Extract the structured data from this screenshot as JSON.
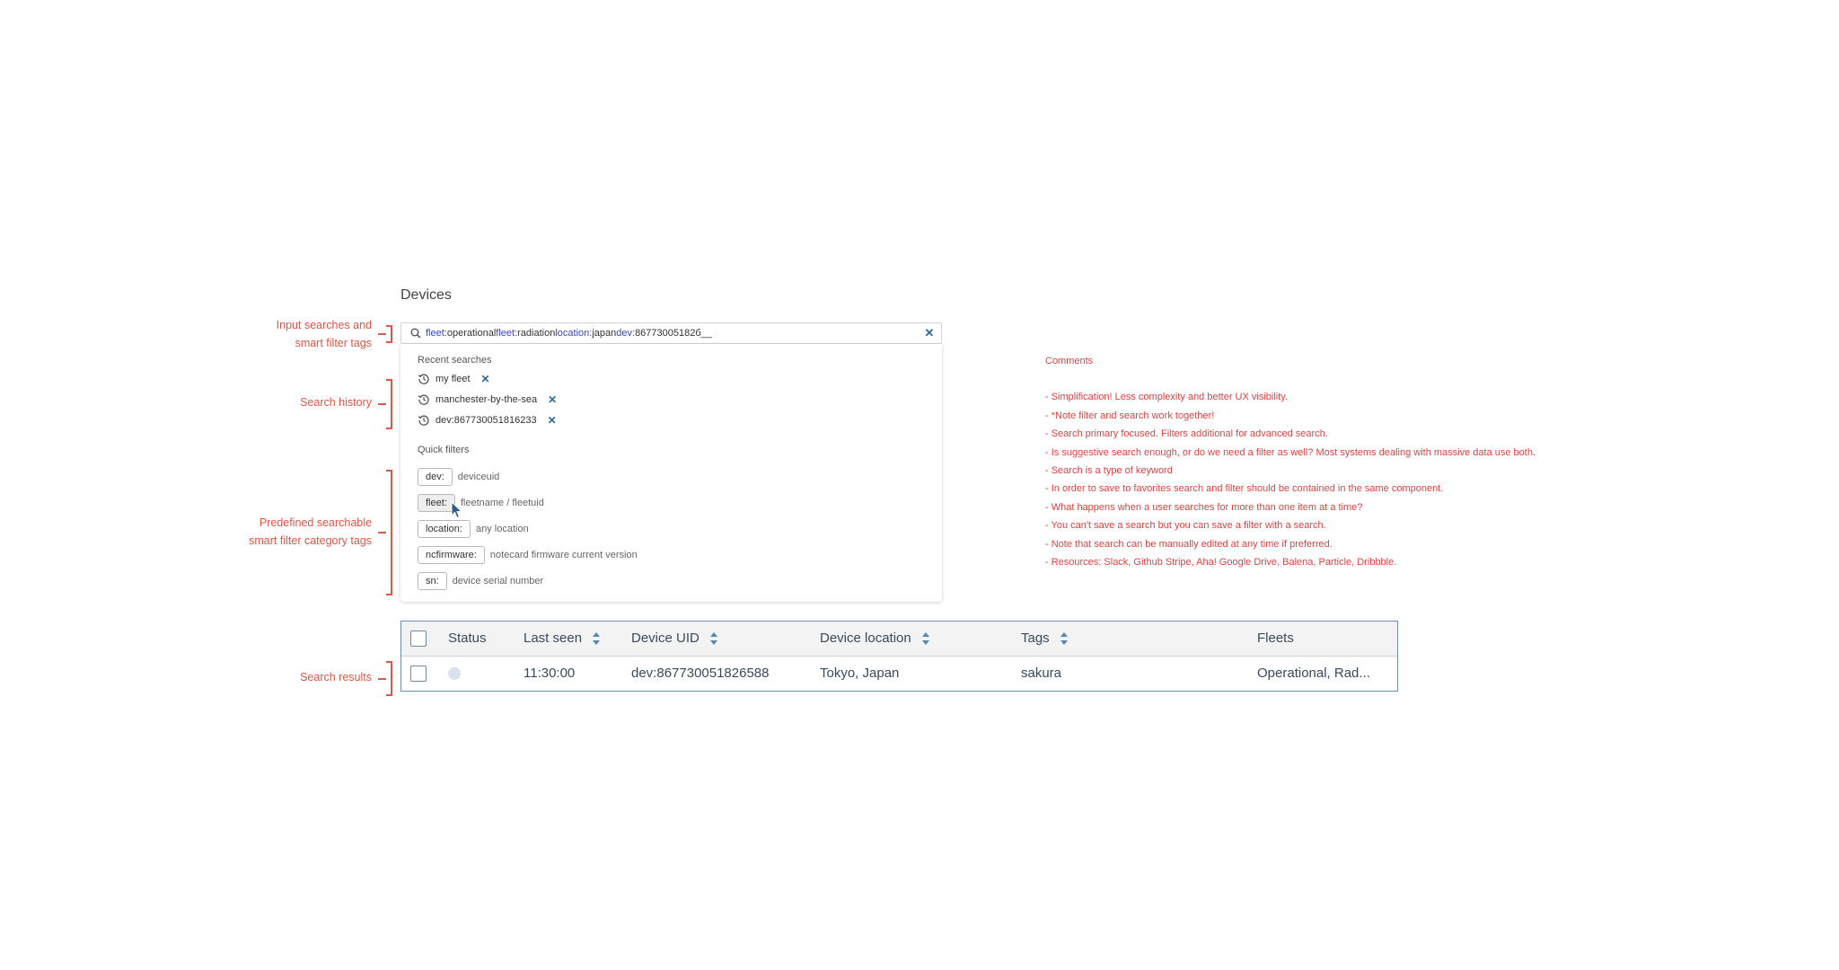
{
  "annotations": {
    "input": "Input searches and smart filter tags",
    "history": "Search history",
    "predefined": "Predefined searchable smart filter category tags",
    "results": "Search results"
  },
  "page": {
    "title": "Devices"
  },
  "search": {
    "tokens": [
      {
        "key": "fleet:",
        "value": "operational "
      },
      {
        "key": "fleet:",
        "value": "radiation "
      },
      {
        "key": "location:",
        "value": "japan "
      },
      {
        "key": "dev:",
        "value": "86773005182б__"
      }
    ],
    "clear_icon": "close-icon"
  },
  "dropdown": {
    "recent_heading": "Recent searches",
    "recent": [
      {
        "label": "my fleet"
      },
      {
        "label": "manchester-by-the-sea"
      },
      {
        "label": "dev:867730051816233"
      }
    ],
    "quick_heading": "Quick filters",
    "quick": [
      {
        "chip": "dev:",
        "desc": "deviceuid"
      },
      {
        "chip": "fleet:",
        "desc": "fleetname / fleetuid"
      },
      {
        "chip": "location:",
        "desc": "any location"
      },
      {
        "chip": "ncfirmware:",
        "desc": "notecard firmware current version"
      },
      {
        "chip": "sn:",
        "desc": "device serial number"
      }
    ]
  },
  "table": {
    "headers": {
      "status": "Status",
      "last_seen": "Last seen",
      "device_uid": "Device UID",
      "device_location": "Device location",
      "tags": "Tags",
      "fleets": "Fleets"
    },
    "rows": [
      {
        "last_seen": "11:30:00",
        "device_uid": "dev:867730051826588",
        "device_location": "Tokyo, Japan",
        "tags": "sakura",
        "fleets": "Operational, Rad..."
      }
    ]
  },
  "comments": {
    "title": "Comments",
    "items": [
      "- Simplification! Less complexity and better UX visibility.",
      "- *Note filter and search work together!",
      "- Search primary focused. Filters additional for advanced search.",
      "- Is suggestive search enough, or do we need a filter as well? Most systems dealing with massive data use both.",
      "- Search is a type of keyword",
      "- In order to save to favorites search and filter should be contained in the same component.",
      "- What happens when a user searches for more than one item at a time?",
      "- You can't save a search but you can save a filter with a search.",
      "- Note that search can be manually edited at any time if preferred.",
      "- Resources: Slack, Github Stripe, Aha! Google Drive, Balena, Particle, Dribbble."
    ]
  },
  "colors": {
    "annotation": "#e05545",
    "token_key": "#3b44c8",
    "accent": "#2e6a9e",
    "table_border": "#6a8fb0"
  }
}
